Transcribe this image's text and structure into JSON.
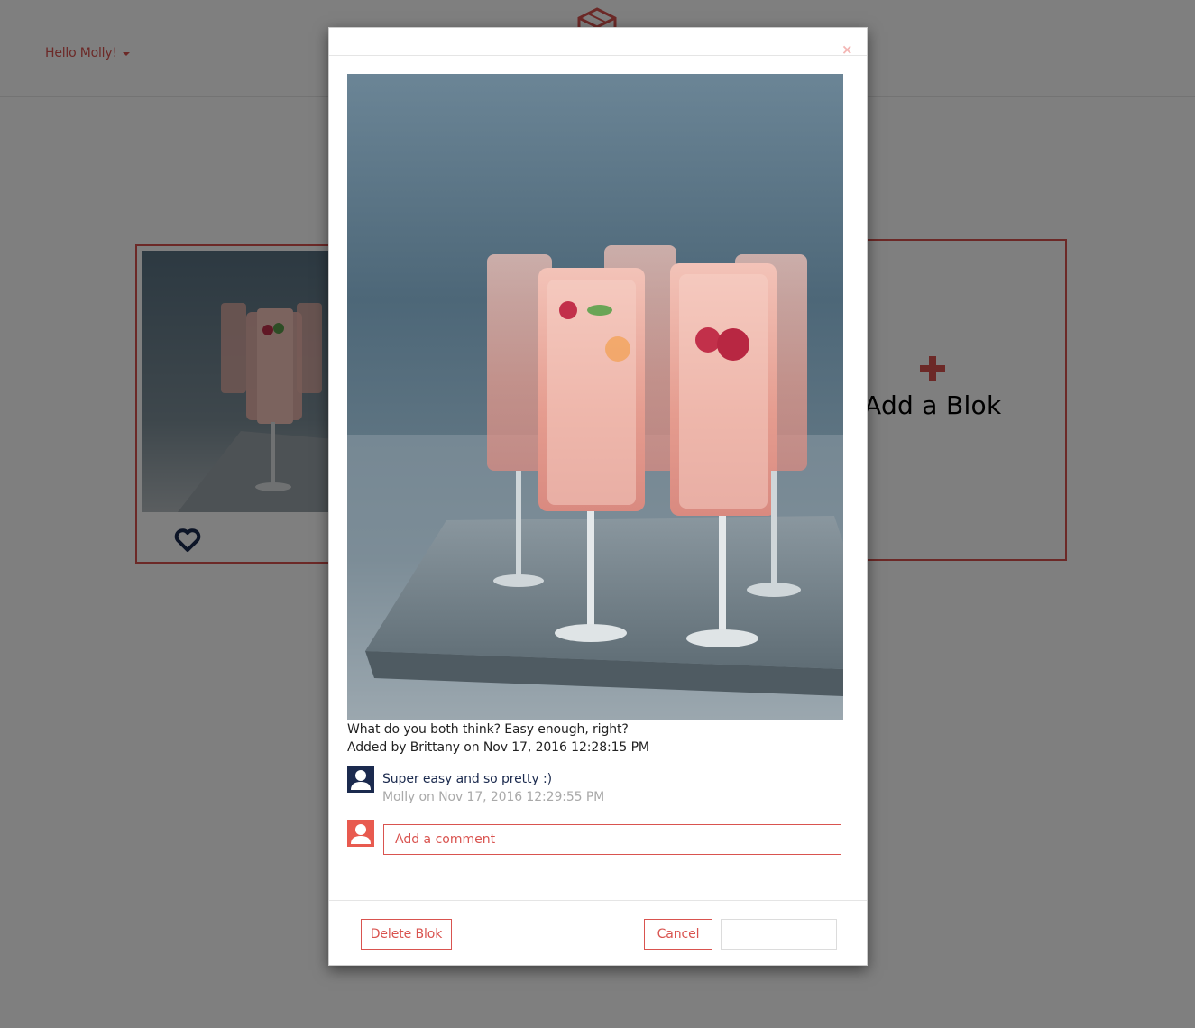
{
  "navbar": {
    "greeting": "Hello Molly!"
  },
  "board": {
    "add_blok_label": "Add a Blok"
  },
  "modal": {
    "close_symbol": "×",
    "caption": "What do you both think? Easy enough, right?",
    "added_by": "Added by Brittany on Nov 17, 2016 12:28:15 PM",
    "comments": [
      {
        "text": "Super easy and so pretty :)",
        "meta": "Molly on Nov 17, 2016 12:29:55 PM"
      }
    ],
    "comment_input": {
      "placeholder": "Add a comment",
      "value": ""
    },
    "footer": {
      "delete_label": "Delete Blok",
      "cancel_label": "Cancel",
      "save_label": ""
    }
  },
  "icons": {
    "logo": "cube-logo-icon",
    "heart": "heart-icon",
    "add": "plus-icon",
    "close": "close-icon",
    "avatar": "user-avatar-icon"
  },
  "colors": {
    "accent": "#d9534f",
    "navy": "#1b2a4e",
    "avatar_self": "#e85a4f",
    "muted_text": "#a9a9a9"
  }
}
